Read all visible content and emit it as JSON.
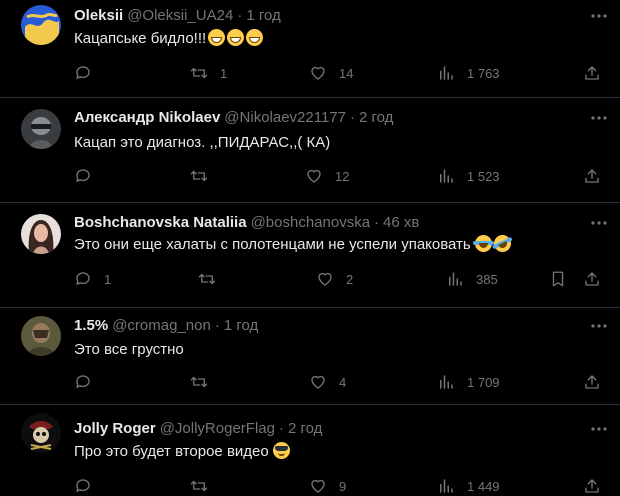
{
  "tweets": [
    {
      "name": "Oleksii",
      "handle": "@Oleksii_UA24",
      "time": "1 год",
      "text": "Кацапське бидло!!!",
      "emojis": [
        "grinning-face-emoji",
        "grinning-face-emoji",
        "grinning-face-emoji"
      ],
      "replies": "",
      "retweets": "1",
      "likes": "14",
      "views": "1 763"
    },
    {
      "name": "Александр Nikolaev",
      "handle": "@Nikolaev221177",
      "time": "2 год",
      "text": "Кацап это диагноз. ,,ПИДАРАС,,( КА)",
      "emojis": [],
      "replies": "",
      "retweets": "",
      "likes": "12",
      "views": "1 523"
    },
    {
      "name": "Boshchanovska Nataliia",
      "handle": "@boshchanovska",
      "time": "46 хв",
      "text": "Это они еще халаты с полотенцами не успели упаковать",
      "emojis": [
        "tears-of-joy-emoji",
        "rolling-laughing-emoji"
      ],
      "replies": "1",
      "retweets": "",
      "likes": "2",
      "views": "385"
    },
    {
      "name": "1.5%",
      "handle": "@cromag_non",
      "time": "1 год",
      "text": "Это все грустно",
      "emojis": [],
      "replies": "",
      "retweets": "",
      "likes": "4",
      "views": "1 709"
    },
    {
      "name": "Jolly Roger",
      "handle": "@JollyRogerFlag",
      "time": "2 год",
      "text": "Про это будет второе видео",
      "emojis": [
        "sunglasses-emoji"
      ],
      "replies": "",
      "retweets": "",
      "likes": "9",
      "views": "1 449"
    }
  ],
  "separator": "·",
  "colors": {
    "background": "#000000",
    "text": "#e7e9ea",
    "secondary": "#71767b",
    "border": "#2f3336"
  }
}
